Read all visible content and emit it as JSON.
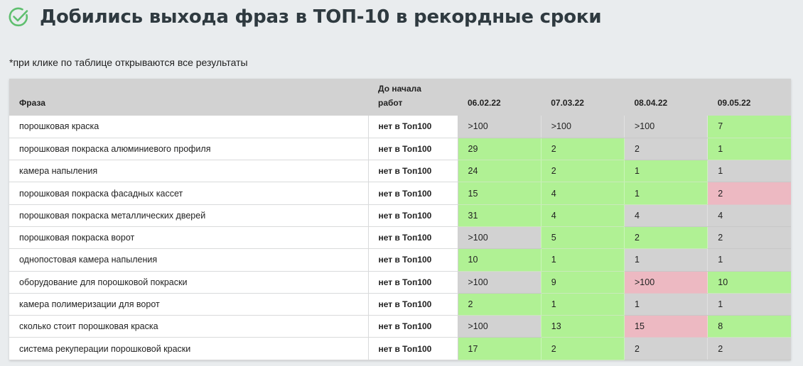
{
  "header": {
    "title": "Добились выхода фраз в ТОП-10 в рекордные сроки",
    "icon": "check-circle-icon",
    "icon_color": "#5fbf6f"
  },
  "note": "*при клике по таблице открываются все результаты",
  "colors": {
    "green": "#b0f194",
    "gray": "#d2d2d2",
    "pink": "#edb9c2"
  },
  "table": {
    "headers": {
      "phrase": "Фраза",
      "start": "До начала\nработ",
      "dates": [
        "06.02.22",
        "07.03.22",
        "08.04.22",
        "09.05.22"
      ]
    },
    "rows": [
      {
        "phrase": "порошковая краска",
        "start": "нет в Топ100",
        "values": [
          ">100",
          ">100",
          ">100",
          "7"
        ],
        "colors": [
          "gray",
          "gray",
          "gray",
          "green"
        ]
      },
      {
        "phrase": "порошковая покраска алюминиевого профиля",
        "start": "нет в Топ100",
        "values": [
          "29",
          "2",
          "2",
          "1"
        ],
        "colors": [
          "green",
          "green",
          "gray",
          "green"
        ]
      },
      {
        "phrase": "камера напыления",
        "start": "нет в Топ100",
        "values": [
          "24",
          "2",
          "1",
          "1"
        ],
        "colors": [
          "green",
          "green",
          "green",
          "gray"
        ]
      },
      {
        "phrase": "порошковая покраска фасадных кассет",
        "start": "нет в Топ100",
        "values": [
          "15",
          "4",
          "1",
          "2"
        ],
        "colors": [
          "green",
          "green",
          "green",
          "pink"
        ]
      },
      {
        "phrase": "порошковая покраска металлических дверей",
        "start": "нет в Топ100",
        "values": [
          "31",
          "4",
          "4",
          "4"
        ],
        "colors": [
          "green",
          "green",
          "gray",
          "gray"
        ]
      },
      {
        "phrase": "порошковая покраска ворот",
        "start": "нет в Топ100",
        "values": [
          ">100",
          "5",
          "2",
          "2"
        ],
        "colors": [
          "gray",
          "green",
          "green",
          "gray"
        ]
      },
      {
        "phrase": "однопостовая камера напыления",
        "start": "нет в Топ100",
        "values": [
          "10",
          "1",
          "1",
          "1"
        ],
        "colors": [
          "green",
          "green",
          "gray",
          "gray"
        ]
      },
      {
        "phrase": "оборудование для порошковой покраски",
        "start": "нет в Топ100",
        "values": [
          ">100",
          "9",
          ">100",
          "10"
        ],
        "colors": [
          "gray",
          "green",
          "pink",
          "green"
        ]
      },
      {
        "phrase": "камера полимеризации для ворот",
        "start": "нет в Топ100",
        "values": [
          "2",
          "1",
          "1",
          "1"
        ],
        "colors": [
          "green",
          "green",
          "gray",
          "gray"
        ]
      },
      {
        "phrase": "сколько стоит порошковая краска",
        "start": "нет в Топ100",
        "values": [
          ">100",
          "13",
          "15",
          "8"
        ],
        "colors": [
          "gray",
          "green",
          "pink",
          "green"
        ]
      },
      {
        "phrase": "система рекуперации порошковой краски",
        "start": "нет в Топ100",
        "values": [
          "17",
          "2",
          "2",
          "2"
        ],
        "colors": [
          "green",
          "green",
          "gray",
          "gray"
        ]
      }
    ]
  }
}
